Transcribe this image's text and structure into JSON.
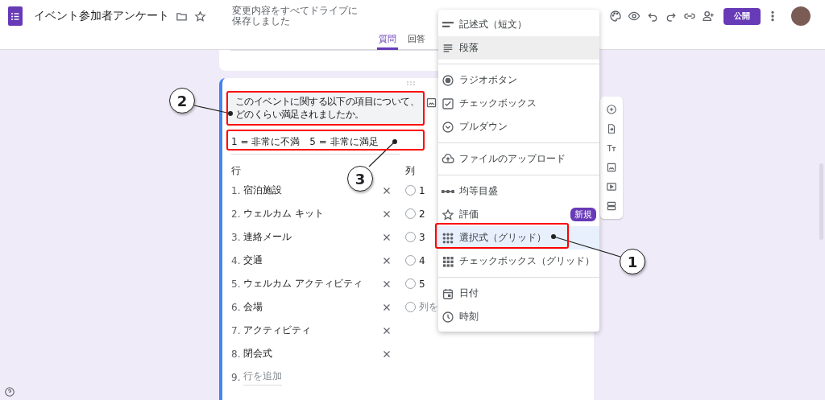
{
  "header": {
    "title": "イベント参加者アンケート",
    "save_status": "変更内容をすべてドライブに保存しました",
    "publish": "公開"
  },
  "tabs": [
    {
      "label": "質問",
      "selected": true
    },
    {
      "label": "回答",
      "selected": false
    }
  ],
  "question": {
    "title": "このイベントに関する以下の項目について、どのくらい満足されましたか。",
    "description": "1 = 非常に不満　5 = 非常に満足",
    "rows_heading": "行",
    "columns_heading": "列",
    "rows": [
      {
        "number": "1.",
        "label": "宿泊施設"
      },
      {
        "number": "2.",
        "label": "ウェルカム キット"
      },
      {
        "number": "3.",
        "label": "連絡メール"
      },
      {
        "number": "4.",
        "label": "交通"
      },
      {
        "number": "5.",
        "label": "ウェルカム アクティビティ"
      },
      {
        "number": "6.",
        "label": "会場"
      },
      {
        "number": "7.",
        "label": "アクティビティ"
      },
      {
        "number": "8.",
        "label": "閉会式"
      }
    ],
    "add_row": {
      "number": "9.",
      "placeholder": "行を追加"
    },
    "columns": [
      "1",
      "2",
      "3",
      "4",
      "5"
    ],
    "add_column": {
      "placeholder": "列を"
    }
  },
  "type_menu": [
    {
      "kind": "short",
      "label": "記述式（短文）",
      "hovered": false,
      "selected": false
    },
    {
      "kind": "paragraph",
      "label": "段落",
      "hovered": true,
      "selected": false
    },
    {
      "kind": "divider"
    },
    {
      "kind": "radio",
      "label": "ラジオボタン",
      "hovered": false,
      "selected": false
    },
    {
      "kind": "checkbox",
      "label": "チェックボックス",
      "hovered": false,
      "selected": false
    },
    {
      "kind": "dropdown",
      "label": "プルダウン",
      "hovered": false,
      "selected": false
    },
    {
      "kind": "divider"
    },
    {
      "kind": "upload",
      "label": "ファイルのアップロード",
      "hovered": false,
      "selected": false
    },
    {
      "kind": "divider"
    },
    {
      "kind": "scale",
      "label": "均等目盛",
      "hovered": false,
      "selected": false
    },
    {
      "kind": "rating",
      "label": "評価",
      "badge": "新規",
      "hovered": false,
      "selected": false
    },
    {
      "kind": "grid",
      "label": "選択式（グリッド）",
      "hovered": false,
      "selected": true
    },
    {
      "kind": "checkgrid",
      "label": "チェックボックス（グリッド）",
      "hovered": false,
      "selected": false
    },
    {
      "kind": "divider"
    },
    {
      "kind": "date",
      "label": "日付",
      "hovered": false,
      "selected": false
    },
    {
      "kind": "time",
      "label": "時刻",
      "hovered": false,
      "selected": false
    }
  ],
  "callouts": [
    {
      "number": "1"
    },
    {
      "number": "2"
    },
    {
      "number": "3"
    }
  ]
}
